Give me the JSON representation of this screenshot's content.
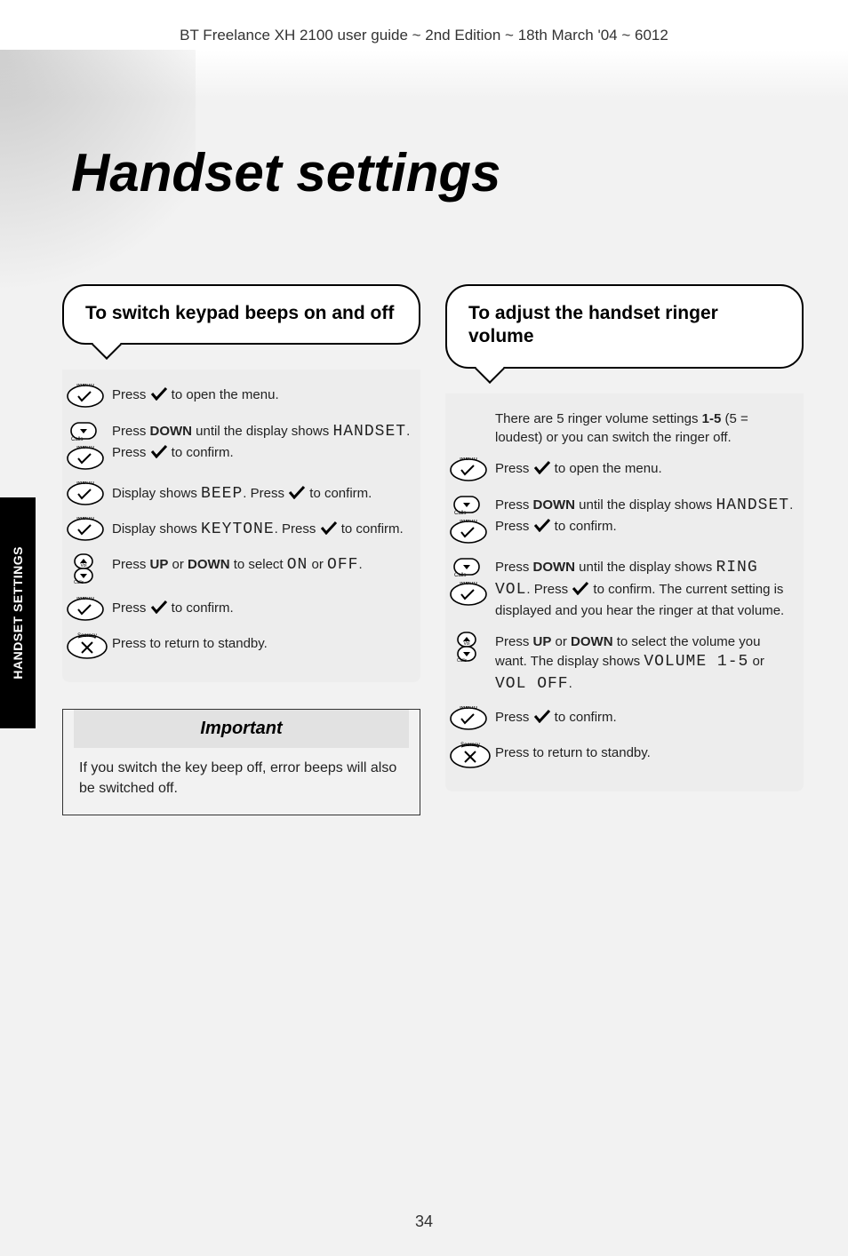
{
  "header_line": "BT Freelance XH 2100 user guide ~ 2nd Edition ~ 18th March '04 ~ 6012",
  "side_tab": "HANDSET SETTINGS",
  "page_title": "Handset settings",
  "page_number": "34",
  "left": {
    "heading": "To switch keypad beeps on and off",
    "step1": "Press ✓ to open the menu.",
    "step2_a": "Press ",
    "step2_down": "DOWN",
    "step2_b": " until the display shows ",
    "step2_handset": "HANDSET",
    "step2_c": ". Press ✓ to confirm.",
    "step3_a": "Display shows ",
    "step3_beep": "BEEP",
    "step3_b": ". Press ✓ to confirm.",
    "step4_a": "Display shows ",
    "step4_keytone": "KEYTONE",
    "step4_b": ". Press ✓ to confirm.",
    "step5_a": "Press ",
    "step5_up": "UP",
    "step5_or1": " or ",
    "step5_down": "DOWN",
    "step5_b": " to select ",
    "step5_on": "ON",
    "step5_or2": " or ",
    "step5_off": "OFF",
    "step5_c": ".",
    "step6": "Press ✓ to confirm.",
    "step7": "Press to return to standby.",
    "note_title": "Important",
    "note_body": "If you switch the key beep off, error beeps will also be switched off."
  },
  "right": {
    "heading": "To adjust the handset ringer volume",
    "intro_a": "There are 5 ringer volume settings ",
    "intro_range": "1-5",
    "intro_b": " (5 = loudest) or you can switch the ringer off.",
    "step1": "Press ✓ to open the menu.",
    "step2_a": "Press ",
    "step2_down": "DOWN",
    "step2_b": " until the display shows ",
    "step2_handset": "HANDSET",
    "step2_c": ". Press ✓ to confirm.",
    "step3_a": "Press ",
    "step3_down": "DOWN",
    "step3_b": " until the display shows ",
    "step3_ringvol": "RING VOL",
    "step3_c": ". Press ✓ to confirm. The current setting is displayed and you hear the ringer at that volume.",
    "step4_a": "Press ",
    "step4_up": "UP",
    "step4_or": " or ",
    "step4_down": "DOWN",
    "step4_b": " to select the volume you want. The display shows ",
    "step4_vol": "VOLUME 1-5",
    "step4_or2": " or ",
    "step4_voloff": "VOL OFF",
    "step4_c": ".",
    "step5": "Press ✓ to confirm.",
    "step6": "Press to return to standby."
  },
  "icons": {
    "menu": "menu-check-button",
    "down": "down-button",
    "updown": "up-down-rocker",
    "secrecy": "secrecy-x-button",
    "check": "check-mark-icon"
  }
}
